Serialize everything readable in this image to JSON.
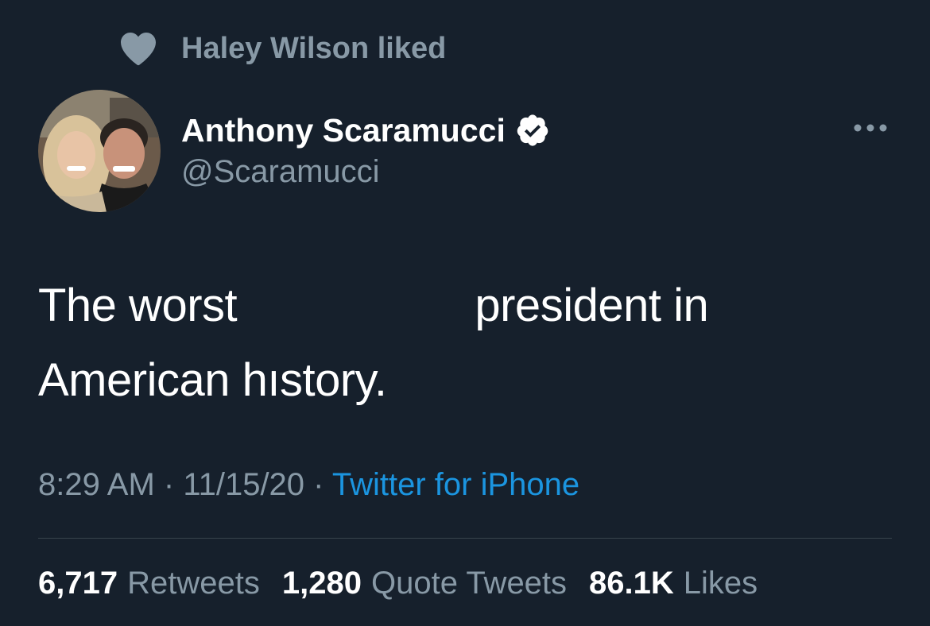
{
  "social_context": {
    "text": "Haley Wilson liked",
    "icon": "heart-icon"
  },
  "author": {
    "display_name": "Anthony Scaramucci",
    "handle": "@Scaramucci",
    "verified_icon": "verified-badge-icon"
  },
  "tweet": {
    "line1_before": "The worst ",
    "line1_after": " president in",
    "line2": "American hıstory."
  },
  "meta": {
    "time": "8:29 AM",
    "separator1": " · ",
    "date": "11/15/20",
    "separator2": " · ",
    "source": "Twitter for iPhone"
  },
  "stats": {
    "retweets_count": "6,717",
    "retweets_label": "Retweets",
    "quotes_count": "1,280",
    "quotes_label": "Quote Tweets",
    "likes_count": "86.1K",
    "likes_label": "Likes"
  },
  "colors": {
    "background": "#16202c",
    "secondary_text": "#8899a6",
    "link": "#1b95e0",
    "divider": "#38444d"
  }
}
